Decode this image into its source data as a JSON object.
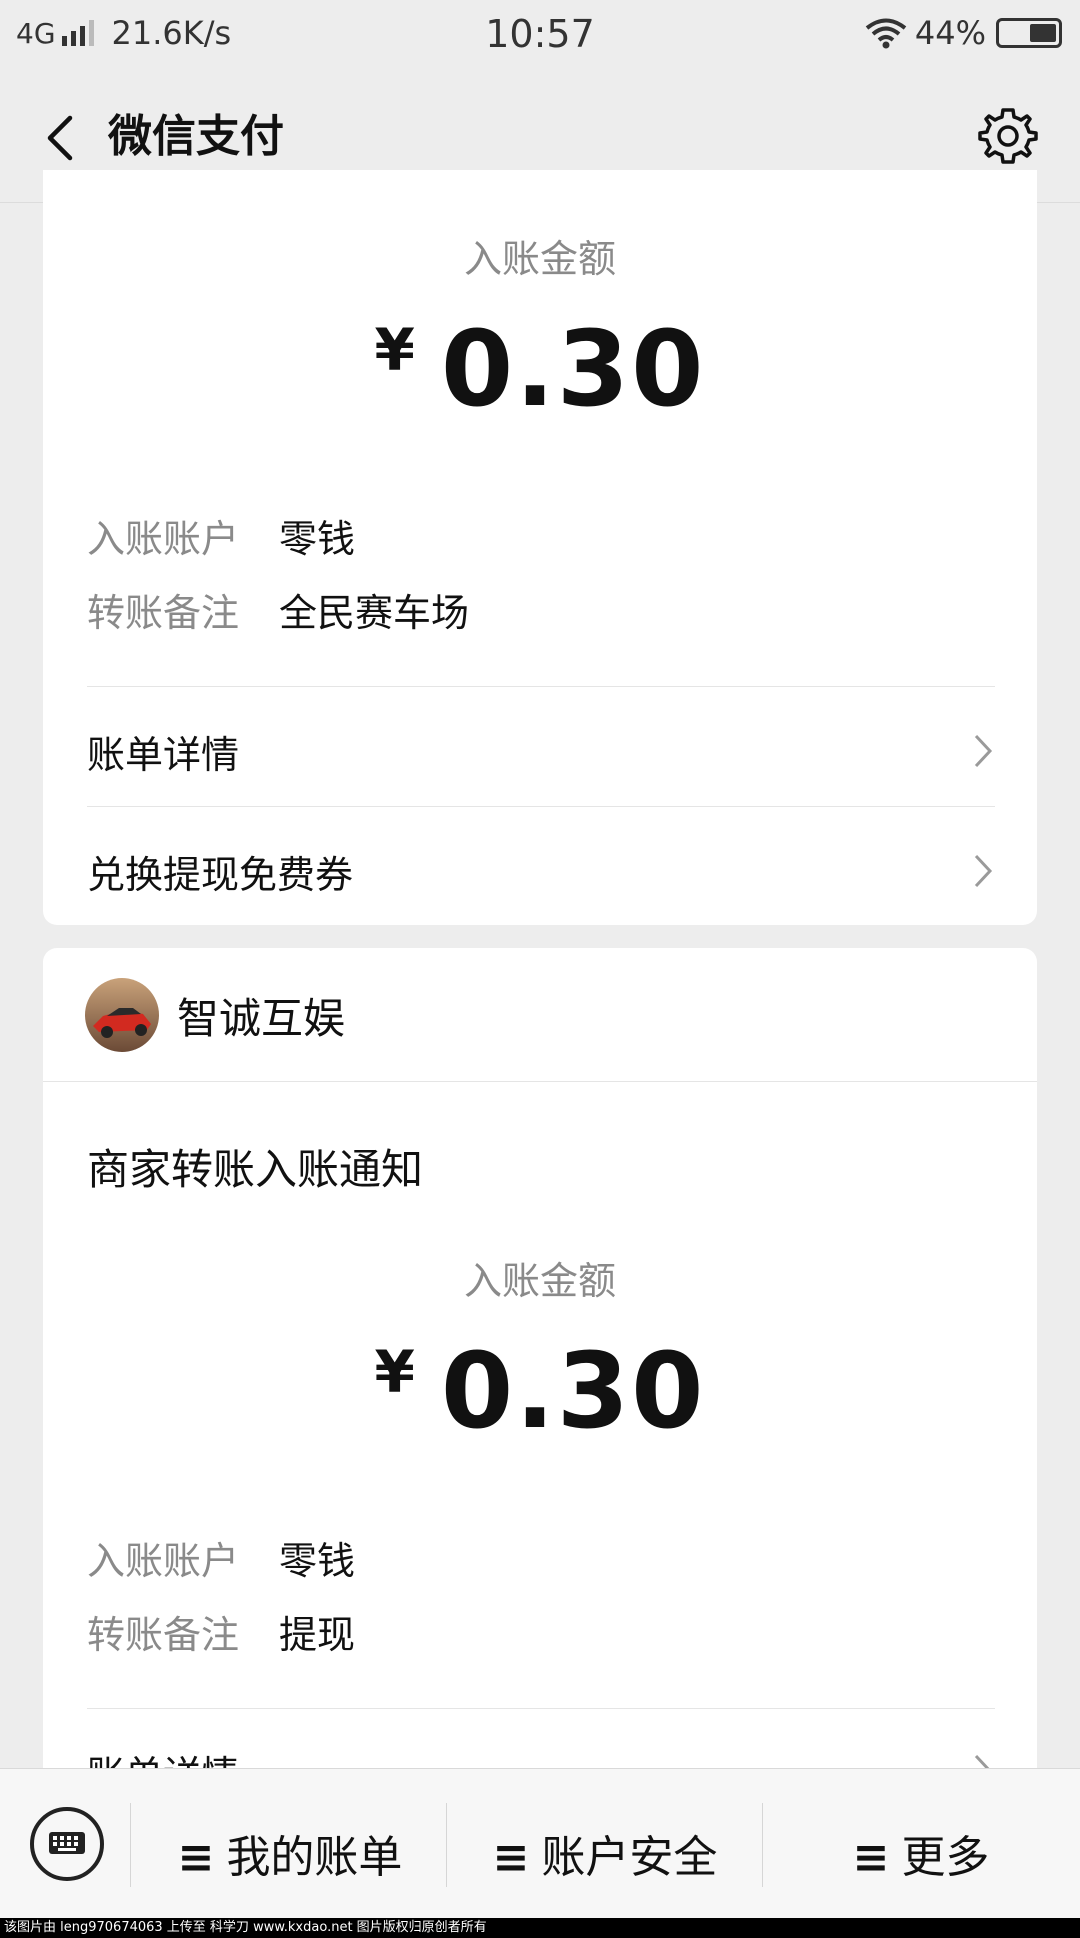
{
  "status_bar": {
    "network": "4G",
    "speed": "21.6K/s",
    "time": "10:57",
    "battery": "44%",
    "battery_level": 0.44
  },
  "header": {
    "title": "微信支付"
  },
  "card1": {
    "amount_label": "入账金额",
    "currency": "¥",
    "amount": "0.30",
    "rows": [
      {
        "key": "入账账户",
        "value": "零钱"
      },
      {
        "key": "转账备注",
        "value": "全民赛车场"
      }
    ],
    "links": [
      "账单详情",
      "兑换提现免费券"
    ]
  },
  "card2": {
    "merchant_name": "智诚互娱",
    "headline": "商家转账入账通知",
    "amount_label": "入账金额",
    "currency": "¥",
    "amount": "0.30",
    "rows": [
      {
        "key": "入账账户",
        "value": "零钱"
      },
      {
        "key": "转账备注",
        "value": "提现"
      }
    ],
    "links": [
      "账单详情"
    ]
  },
  "bottom_menu": {
    "items": [
      "我的账单",
      "账户安全",
      "更多"
    ],
    "ham": "≡"
  },
  "footer": {
    "text": "该图片由 leng970674063 上传至 科学刀 www.kxdao.net 图片版权归原创者所有"
  },
  "icons": [
    "back-icon",
    "gear-icon",
    "chevron-right-icon",
    "keyboard-icon",
    "signal-icon",
    "wifi-icon",
    "battery-icon"
  ]
}
